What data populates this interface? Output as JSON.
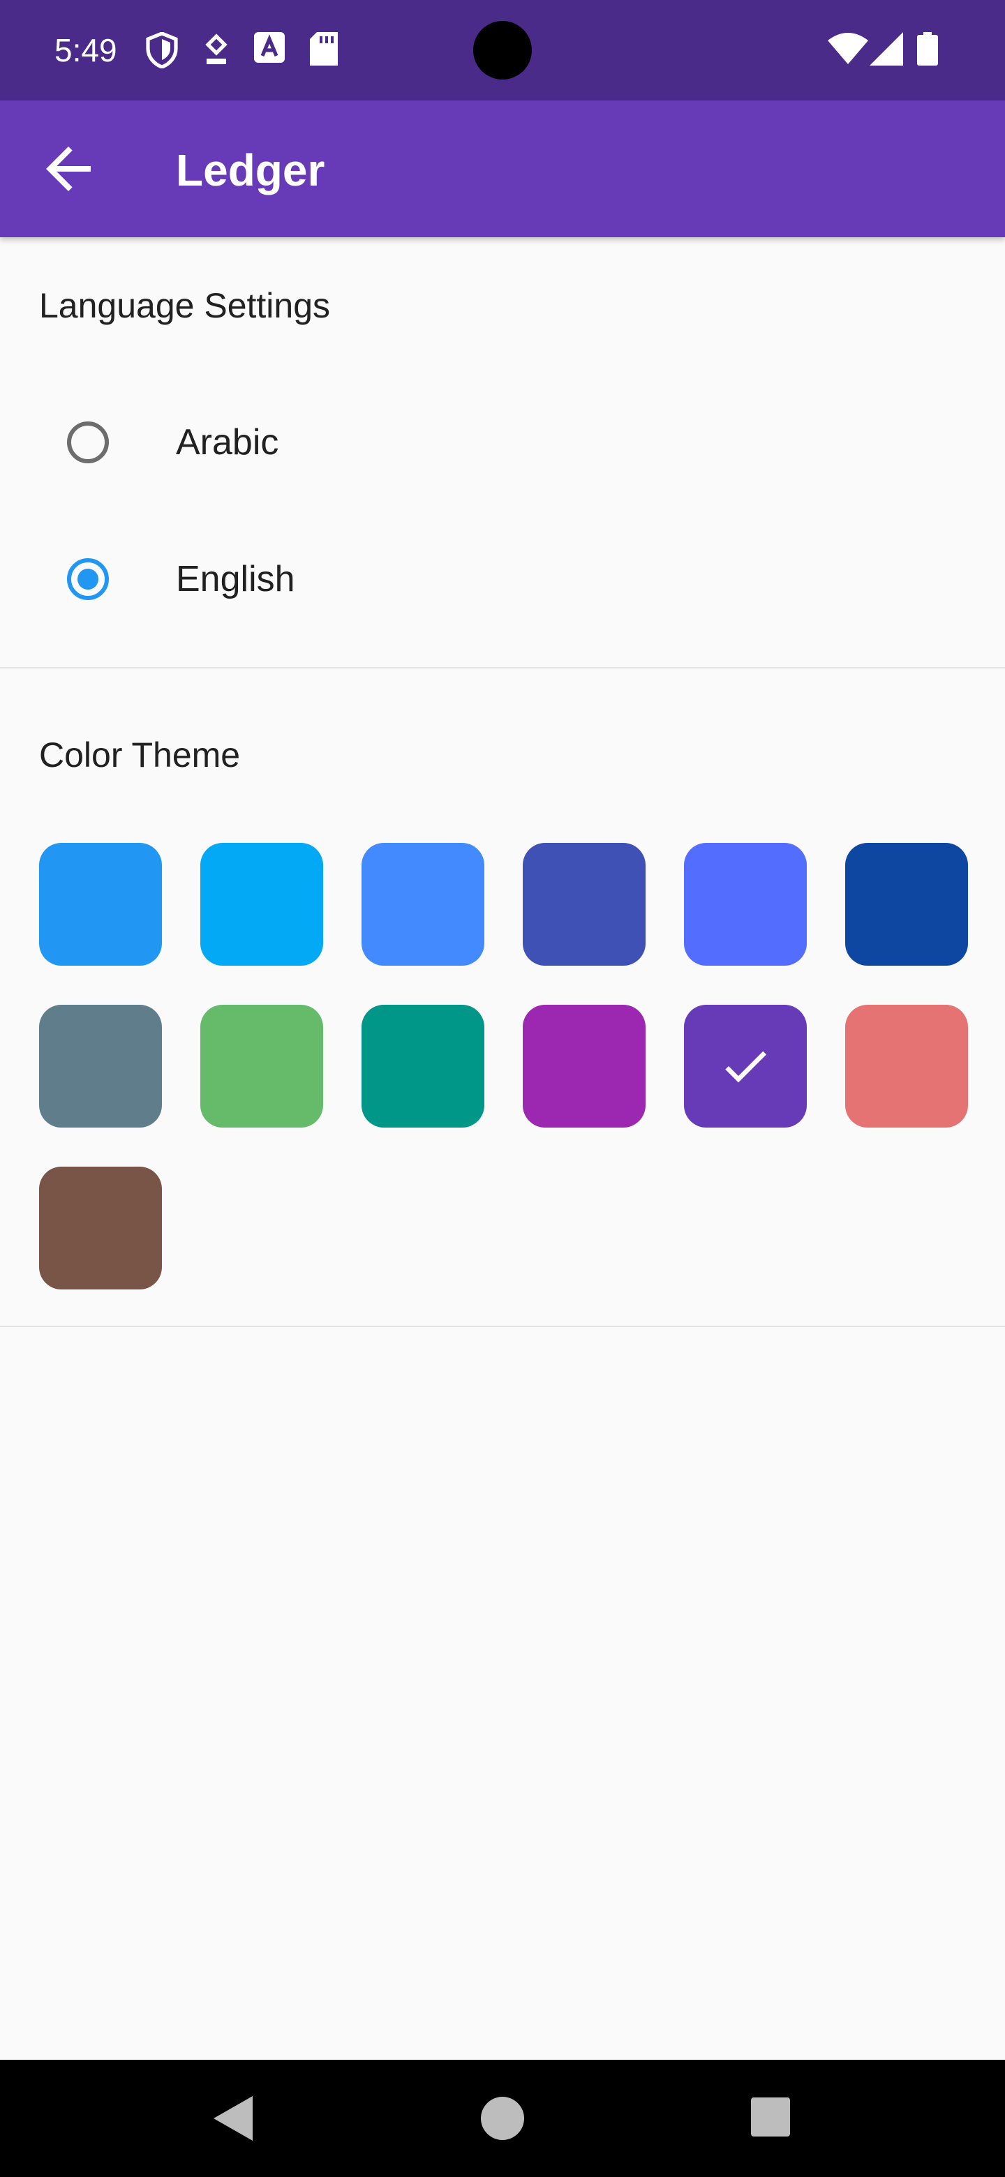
{
  "status_bar": {
    "time": "5:49",
    "background": "#4b2b89"
  },
  "app_bar": {
    "title": "Ledger",
    "background": "#673ab7",
    "back_icon": "arrow-back-icon"
  },
  "language_section": {
    "title": "Language Settings",
    "options": [
      {
        "label": "Arabic",
        "selected": false
      },
      {
        "label": "English",
        "selected": true
      }
    ]
  },
  "theme_section": {
    "title": "Color Theme",
    "selected_color": "#673ab7",
    "colors": [
      "#2196f3",
      "#03a9f4",
      "#448aff",
      "#3f51b5",
      "#536dfe",
      "#0d47a1",
      "#607d8b",
      "#66bb6a",
      "#009688",
      "#9c27b0",
      "#673ab7",
      "#e57373",
      "#795548"
    ]
  },
  "nav_bar": {
    "buttons": [
      "back-triangle-icon",
      "home-circle-icon",
      "recents-square-icon"
    ]
  }
}
